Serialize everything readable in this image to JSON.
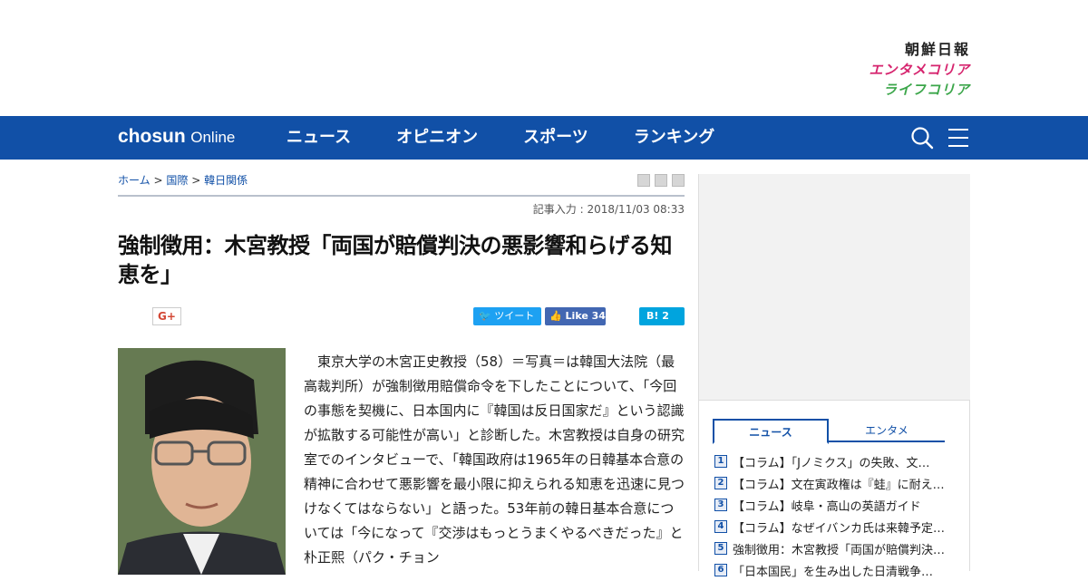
{
  "brand": {
    "chosun_ilbo": "朝鮮日報",
    "entame_korea": "エンタメコリア",
    "life_korea": "ライフコリア"
  },
  "nav": {
    "logo_bold": "chosun",
    "logo_light": "Online",
    "items": [
      "ニュース",
      "オピニオン",
      "スポーツ",
      "ランキング"
    ],
    "search_icon": "search-icon",
    "menu_icon": "hamburger-menu-icon"
  },
  "breadcrumb": {
    "home": "ホーム",
    "sep": ">",
    "category": "国際",
    "subcategory": "韓日関係"
  },
  "article": {
    "date": "記事入力 : 2018/11/03 08:33",
    "title": "強制徴用：木宮教授「両国が賠償判決の悪影響和らげる知恵を」",
    "body": "東京大学の木宮正史教授（58）＝写真＝は韓国大法院（最高裁判所）が強制徴用賠償命令を下したことについて、「今回の事態を契機に、日本国内に『韓国は反日国家だ』という認識が拡散する可能性が高い」と診断した。木宮教授は自身の研究室でのインタビューで、「韓国政府は1965年の日韓基本合意の精神に合わせて悪影響を最小限に抑えられる知恵を迅速に見つけなくてはならない」と語った。53年前の韓日基本合意については「今になって『交渉はもっとうまくやるべきだった』と朴正熙（パク・チョン"
  },
  "share": {
    "gplus": "G+",
    "tweet": "ツイート",
    "like": "Like",
    "like_count": "34",
    "hatena": "B!",
    "hatena_count": "2"
  },
  "sidebar": {
    "tabs": [
      "ニュース",
      "エンタメ"
    ],
    "ranking": [
      {
        "num": "1",
        "text": "【コラム】「Jノミクス」の失敗、文…"
      },
      {
        "num": "2",
        "text": "【コラム】文在寅政権は『蛙』に耐え…"
      },
      {
        "num": "3",
        "text": "【コラム】岐阜・高山の英語ガイド"
      },
      {
        "num": "4",
        "text": "【コラム】なぜイバンカ氏は来韓予定…"
      },
      {
        "num": "5",
        "text": "強制徴用：木宮教授「両国が賠償判決…"
      },
      {
        "num": "6",
        "text": "「日本国民」を生み出した日清戦争…"
      }
    ]
  }
}
